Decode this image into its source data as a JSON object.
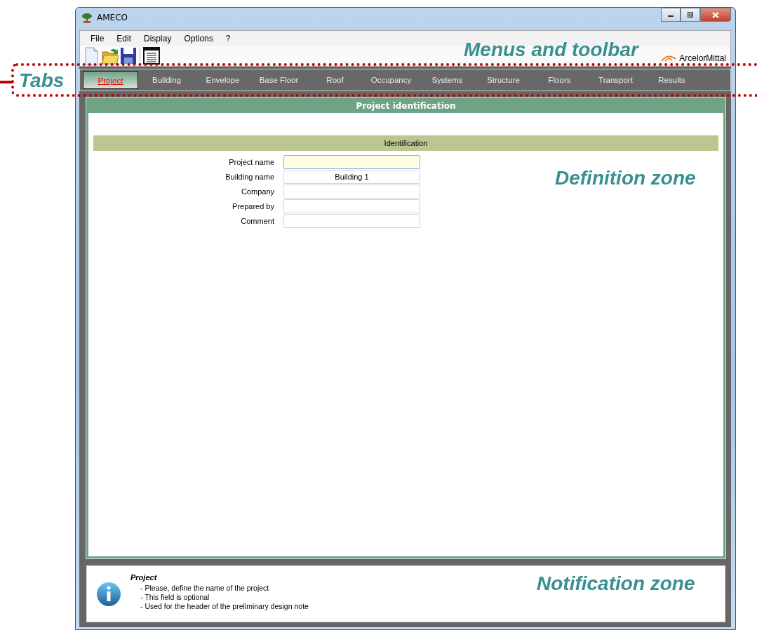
{
  "window": {
    "title": "AMECO"
  },
  "menu": [
    "File",
    "Edit",
    "Display",
    "Options",
    "?"
  ],
  "toolbar": [
    {
      "kind": "new"
    },
    {
      "kind": "open"
    },
    {
      "kind": "save"
    },
    {
      "kind": "report"
    }
  ],
  "brand": "ArcelorMittal",
  "tabs": [
    {
      "label": "Project",
      "selected": true
    },
    {
      "label": "Building",
      "selected": false
    },
    {
      "label": "Envelope",
      "selected": false
    },
    {
      "label": "Base Floor",
      "selected": false
    },
    {
      "label": "Roof",
      "selected": false
    },
    {
      "label": "Occupancy",
      "selected": false
    },
    {
      "label": "Systems",
      "selected": false
    },
    {
      "label": "Structure",
      "selected": false
    },
    {
      "label": "Floors",
      "selected": false
    },
    {
      "label": "Transport",
      "selected": false
    },
    {
      "label": "Results",
      "selected": false
    }
  ],
  "panel": {
    "title": "Project identification",
    "section": "Identification",
    "fields": [
      {
        "label": "Project name",
        "focused": true
      },
      {
        "label": "Building name",
        "value": "Building 1",
        "focused": false
      },
      {
        "label": "Company",
        "focused": false
      },
      {
        "label": "Prepared by",
        "focused": false
      },
      {
        "label": "Comment",
        "focused": false
      }
    ]
  },
  "notification": {
    "title": "Project",
    "lines": [
      "- Please, define the name of the project",
      "- This field is optional",
      "- Used for the header of the preliminary design note"
    ]
  },
  "annotations": [
    {
      "kind": "menus",
      "text": "Menus and toolbar"
    },
    {
      "kind": "tabs",
      "text": "Tabs"
    },
    {
      "kind": "definition",
      "text": "Definition zone"
    },
    {
      "kind": "notification",
      "text": "Notification zone"
    }
  ]
}
